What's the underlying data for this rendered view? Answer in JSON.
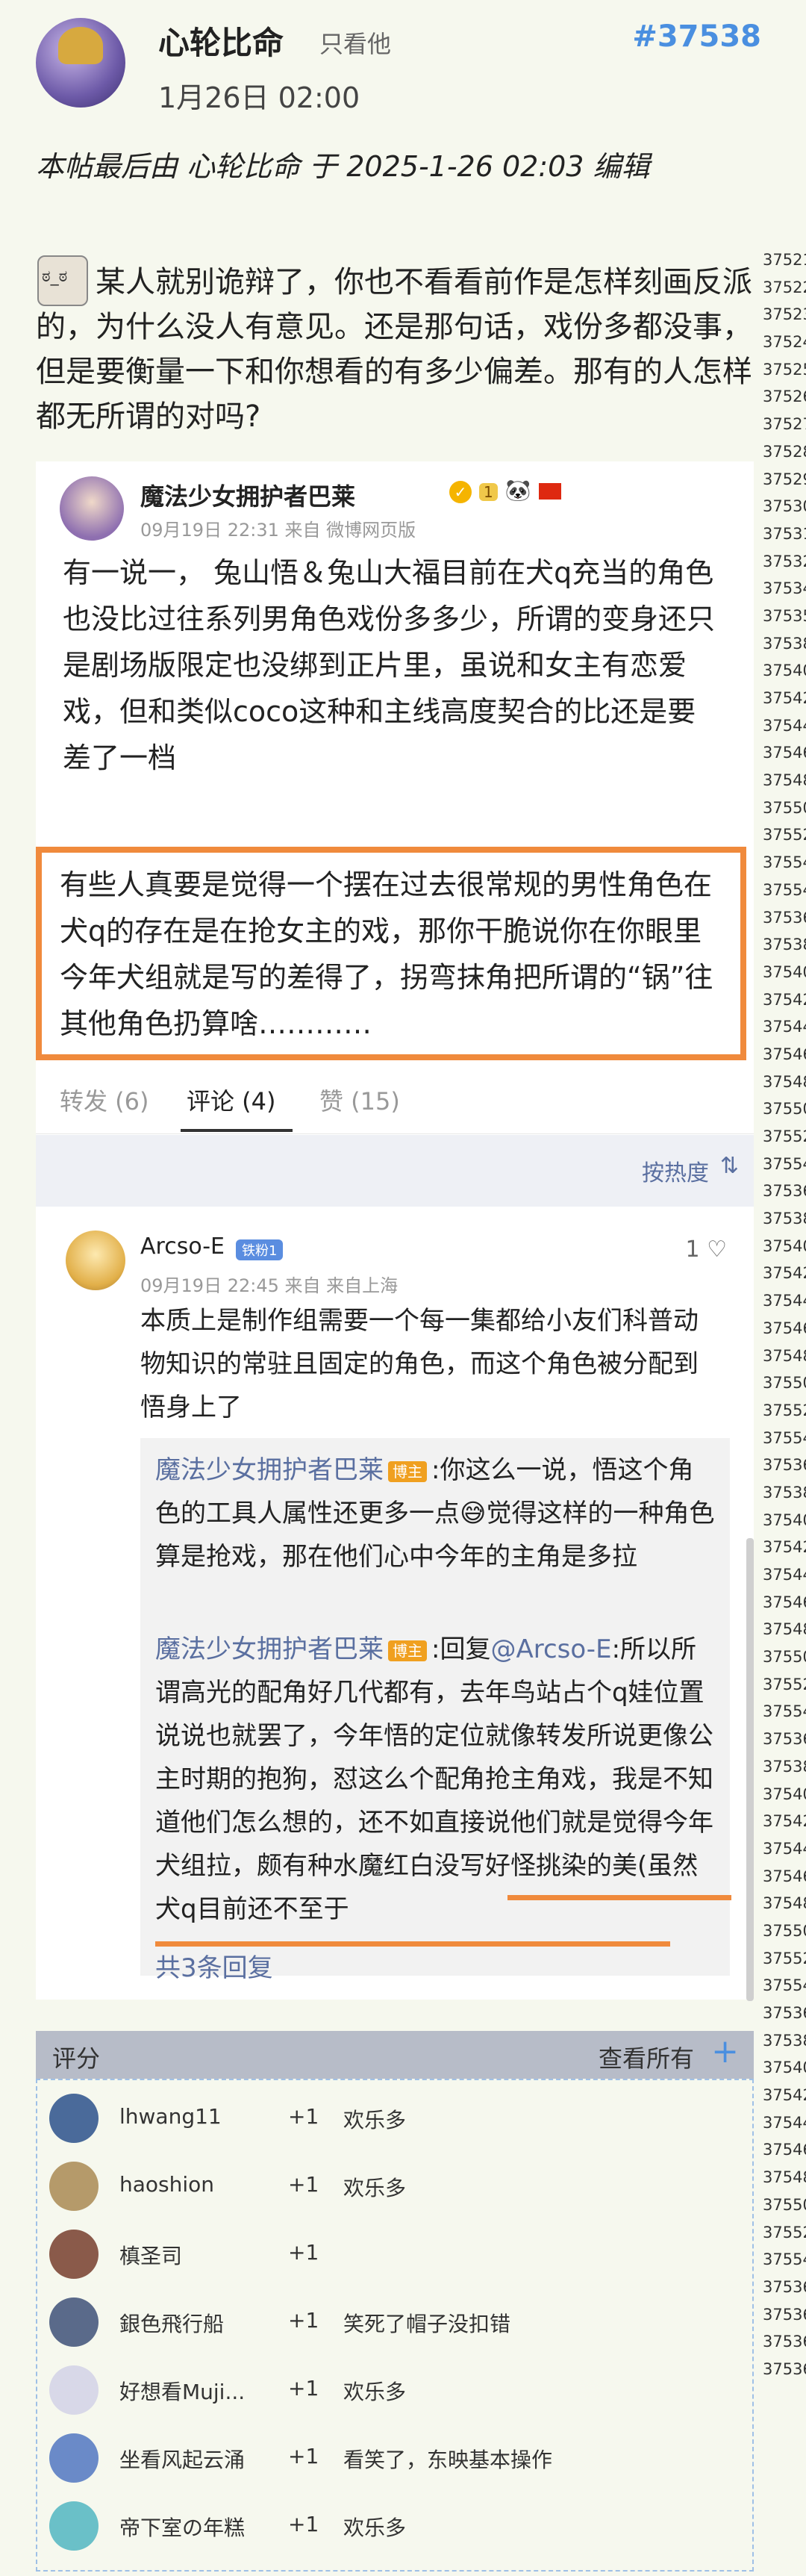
{
  "post": {
    "poster_name": "心轮比命",
    "only_him": "只看他",
    "post_number": "#37538",
    "time": "1月26日 02:00",
    "edited_note": "本帖最后由 心轮比命 于 2025-1-26 02:03 编辑",
    "body": "某人就别诡辩了，你也不看看前作是怎样刻画反派的，为什么没人有意见。还是那句话，戏份多都没事，但是要衡量一下和你想看的有多少偏差。那有的人怎样都无所谓的对吗?"
  },
  "line_numbers": [
    "37521",
    "37522",
    "37523",
    "37524",
    "37525",
    "37526",
    "37527",
    "37528",
    "37529",
    "37530",
    "37531",
    "37532",
    "37534",
    "37535",
    "37538",
    "37540",
    "37542",
    "37544",
    "37546",
    "37548",
    "37550",
    "37552",
    "37554",
    "37554",
    "37536",
    "37538",
    "37540",
    "37542",
    "37544",
    "37546",
    "37548",
    "37550",
    "37552",
    "37554",
    "37536",
    "37538",
    "37540",
    "37542",
    "37544",
    "37546",
    "37548",
    "37550",
    "37552",
    "37554",
    "37536",
    "37538",
    "37540",
    "37542",
    "37544",
    "37546",
    "37548",
    "37550",
    "37552",
    "37554",
    "37536",
    "37538",
    "37540",
    "37542",
    "37544",
    "37546",
    "37548",
    "37550",
    "37552",
    "37554",
    "37536",
    "37538",
    "37540",
    "37542",
    "37544",
    "37546",
    "37548",
    "37550",
    "37552",
    "37554",
    "37536",
    "37536",
    "37536",
    "37536"
  ],
  "weibo": {
    "author": "魔法少女拥护者巴莱",
    "level": "1",
    "meta": "09月19日 22:31  来自 微博网页版",
    "text": "有一说一， 兔山悟＆兔山大福目前在犬q充当的角色也没比过往系列男角色戏份多多少，所谓的变身还只是剧场版限定也没绑到正片里，虽说和女主有恋爱戏，但和类似coco这种和主线高度契合的比还是要差了一档",
    "highlight_text": "有些人真要是觉得一个摆在过去很常规的男性角色在犬q的存在是在抢女主的戏，那你干脆说你在你眼里今年犬组就是写的差得了，拐弯抹角把所谓的“锅”往其他角色扔算啥…………",
    "tabs": {
      "repost": "转发 (6)",
      "comment": "评论 (4)",
      "like": "赞 (15)"
    },
    "sort_label": "按热度",
    "comment": {
      "name": "Arcso-E",
      "badge": "铁粉1",
      "likes": "1",
      "meta": "09月19日 22:45  来自 来自上海",
      "text": "本质上是制作组需要一个每一集都给小友们科普动物知识的常驻且固定的角色，而这个角色被分配到悟身上了"
    },
    "replies": {
      "r1_name": "魔法少女拥护者巴莱",
      "r1_badge": "博主",
      "r1_text_a": ":你这么一说，悟这个角色的工具人属性还更多一点",
      "r1_text_b": "觉得这样的一种角色算是抢戏，那在他们心中今年的主角是多拉",
      "r2_name": "魔法少女拥护者巴莱",
      "r2_badge": "博主",
      "r2_prefix": ":回复",
      "r2_mention": "@Arcso-E",
      "r2_text": ":所以所谓高光的配角好几代都有，去年鸟站占个q娃位置说说也就罢了，今年悟的定位就像转发所说更像公主时期的抱狗，怼这么个配角抢主角戏，我是不知道他们怎么想的，还不如直接说他们就是觉得今年犬组拉，颇有种水魔红白没写好怪挑染的美(虽然犬q目前还不至于",
      "more": "共3条回复"
    }
  },
  "rating": {
    "title": "评分",
    "view_all": "查看所有",
    "rows": [
      {
        "name": "lhwang11",
        "score": "+1",
        "reason": "欢乐多",
        "color": "#4a6a9a"
      },
      {
        "name": "haoshion",
        "score": "+1",
        "reason": "欢乐多",
        "color": "#b59a6a"
      },
      {
        "name": "槙圣司",
        "score": "+1",
        "reason": "",
        "color": "#8a5a4a"
      },
      {
        "name": "銀色飛行船",
        "score": "+1",
        "reason": "笑死了帽子没扣错",
        "color": "#5a6a8a"
      },
      {
        "name": "好想看Muji...",
        "score": "+1",
        "reason": "欢乐多",
        "color": "#d8d8e8"
      },
      {
        "name": "坐看风起云涌",
        "score": "+1",
        "reason": "看笑了，东映基本操作",
        "color": "#6a8ac8"
      },
      {
        "name": "帝下室の年糕",
        "score": "+1",
        "reason": "欢乐多",
        "color": "#6ac0c8"
      }
    ]
  }
}
